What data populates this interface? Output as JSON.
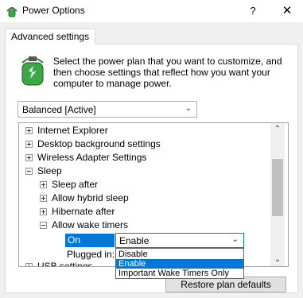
{
  "window": {
    "title": "Power Options",
    "help_label": "?",
    "close_label": "✕"
  },
  "tabs": [
    {
      "label": "Advanced settings"
    }
  ],
  "intro": {
    "lines": [
      "Select the power plan that you want to customize, and",
      "then choose settings that reflect how you want your",
      "computer to manage power."
    ]
  },
  "plan_select": {
    "value": "Balanced [Active]"
  },
  "tree": {
    "items": [
      {
        "label": "Internet Explorer",
        "state": "collapsed"
      },
      {
        "label": "Desktop background settings",
        "state": "collapsed"
      },
      {
        "label": "Wireless Adapter Settings",
        "state": "collapsed"
      },
      {
        "label": "Sleep",
        "state": "expanded"
      },
      {
        "label": "Sleep after",
        "state": "collapsed"
      },
      {
        "label": "Allow hybrid sleep",
        "state": "collapsed"
      },
      {
        "label": "Hibernate after",
        "state": "collapsed"
      },
      {
        "label": "Allow wake timers",
        "state": "expanded"
      },
      {
        "label": "USB settings",
        "state": "collapsed"
      }
    ],
    "on_battery_label": "On battery:",
    "plugged_in_label": "Plugged in:",
    "wake_timers": {
      "value": "Enable",
      "options": [
        "Disable",
        "Enable",
        "Important Wake Timers Only"
      ],
      "selected_option": "Enable"
    }
  },
  "buttons": {
    "restore": "Restore plan defaults"
  },
  "colors": {
    "accent": "#0078d7",
    "icon_green": "#3aa845",
    "dialog_bg": "#f0f0f0"
  },
  "icons": {
    "app": "power-options-icon",
    "expand": "plus-icon",
    "collapse": "minus-icon",
    "dropdown": "chevron-down-icon",
    "scroll_up": "scroll-up-arrow",
    "scroll_down": "scroll-down-arrow"
  }
}
